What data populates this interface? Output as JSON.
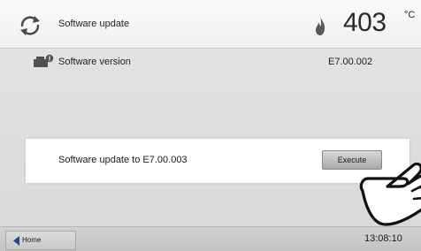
{
  "header": {
    "title": "Software update",
    "temperature": "403",
    "temperature_unit": "°C",
    "icons": {
      "left": "refresh-icon",
      "status": "flame-icon"
    }
  },
  "version_row": {
    "label": "Software version",
    "value": "E7.00.002",
    "icon": "device-icon"
  },
  "dialog": {
    "message": "Software update to E7.00.003",
    "button_label": "Execute"
  },
  "footer": {
    "home_label": "Home",
    "clock": "13:08:10",
    "home_icon": "arrow-left-icon"
  },
  "overlay": {
    "icon": "pointing-hand-icon"
  },
  "colors": {
    "background": "#dedede",
    "header": "#f4f4f4",
    "accent_blue": "#1e4a8a",
    "button_gray": "#bdbdbd"
  }
}
